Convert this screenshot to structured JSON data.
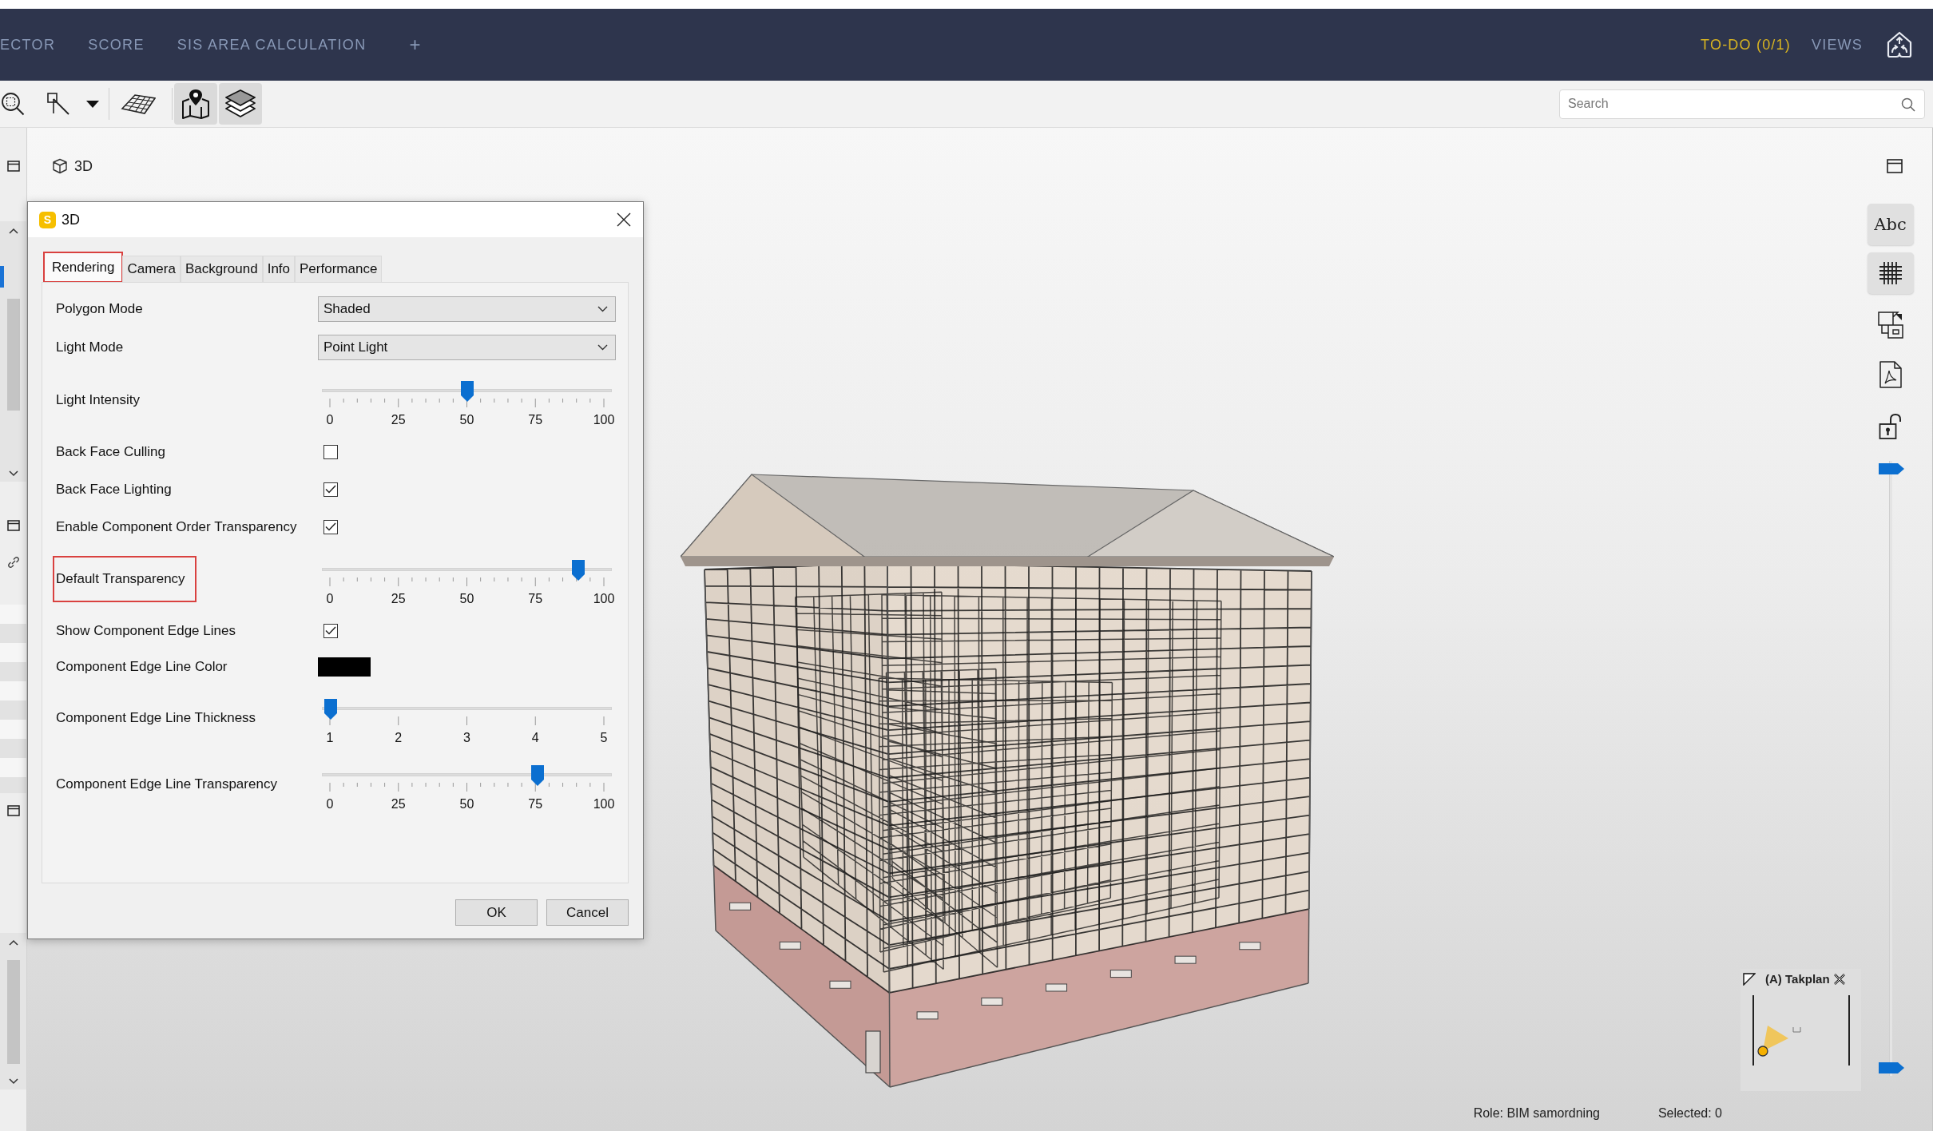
{
  "nav": {
    "tabs": [
      {
        "label": "ECTOR"
      },
      {
        "label": "SCORE"
      },
      {
        "label": "SIS AREA CALCULATION"
      }
    ],
    "add_tab": "+",
    "todo": "TO-DO (0/1)",
    "views": "VIEWS"
  },
  "toolbar": {
    "toggles": [
      {
        "selected": true
      },
      {
        "selected": true
      }
    ],
    "search": {
      "placeholder": "Search"
    }
  },
  "view_tab": {
    "label": "3D"
  },
  "dialog": {
    "logo": "S",
    "title": "3D",
    "tabs": [
      {
        "label": "Rendering",
        "selected": true,
        "highlighted": true
      },
      {
        "label": "Camera",
        "selected": false,
        "highlighted": false
      },
      {
        "label": "Background",
        "selected": false,
        "highlighted": false
      },
      {
        "label": "Info",
        "selected": false,
        "highlighted": false
      },
      {
        "label": "Performance",
        "selected": false,
        "highlighted": false
      }
    ],
    "settings": [
      {
        "kind": "dropdown",
        "label": "Polygon Mode",
        "value": "Shaded",
        "highlighted": false
      },
      {
        "kind": "dropdown",
        "label": "Light Mode",
        "value": "Point Light",
        "highlighted": false
      },
      {
        "kind": "slider",
        "label": "Light Intensity",
        "level": 0.5,
        "ticks": [
          "0",
          "25",
          "50",
          "75",
          "100"
        ],
        "minor_ticks": true,
        "highlighted": false
      },
      {
        "kind": "checkbox",
        "label": "Back Face Culling",
        "checked": false,
        "highlighted": false
      },
      {
        "kind": "checkbox",
        "label": "Back Face Lighting",
        "checked": true,
        "highlighted": false
      },
      {
        "kind": "checkbox",
        "label": "Enable Component Order Transparency",
        "checked": true,
        "highlighted": false
      },
      {
        "kind": "slider",
        "label": "Default Transparency",
        "level": 0.91,
        "ticks": [
          "0",
          "25",
          "50",
          "75",
          "100"
        ],
        "minor_ticks": true,
        "highlighted": true
      },
      {
        "kind": "checkbox",
        "label": "Show Component Edge Lines",
        "checked": true,
        "highlighted": false
      },
      {
        "kind": "color",
        "label": "Component Edge Line Color",
        "color": "#000000",
        "highlighted": false
      },
      {
        "kind": "slider",
        "label": "Component Edge Line Thickness",
        "level": 0,
        "ticks": [
          "1",
          "2",
          "3",
          "4",
          "5"
        ],
        "minor_ticks": false,
        "highlighted": false
      },
      {
        "kind": "slider",
        "label": "Component Edge Line Transparency",
        "level": 0.76,
        "ticks": [
          "0",
          "25",
          "50",
          "75",
          "100"
        ],
        "minor_ticks": true,
        "highlighted": false
      }
    ],
    "buttons": [
      "OK",
      "Cancel"
    ]
  },
  "side_tools": {
    "text_button": {
      "label": "Abc",
      "selected": true
    },
    "grid_button": {
      "selected": true
    },
    "range": [
      {
        "level": 1
      },
      {
        "level": 0
      }
    ]
  },
  "minimap": {
    "title": "(A) Takplan"
  },
  "status_bar": {
    "role": "Role: BIM samordning",
    "selection": "Selected: 0"
  }
}
